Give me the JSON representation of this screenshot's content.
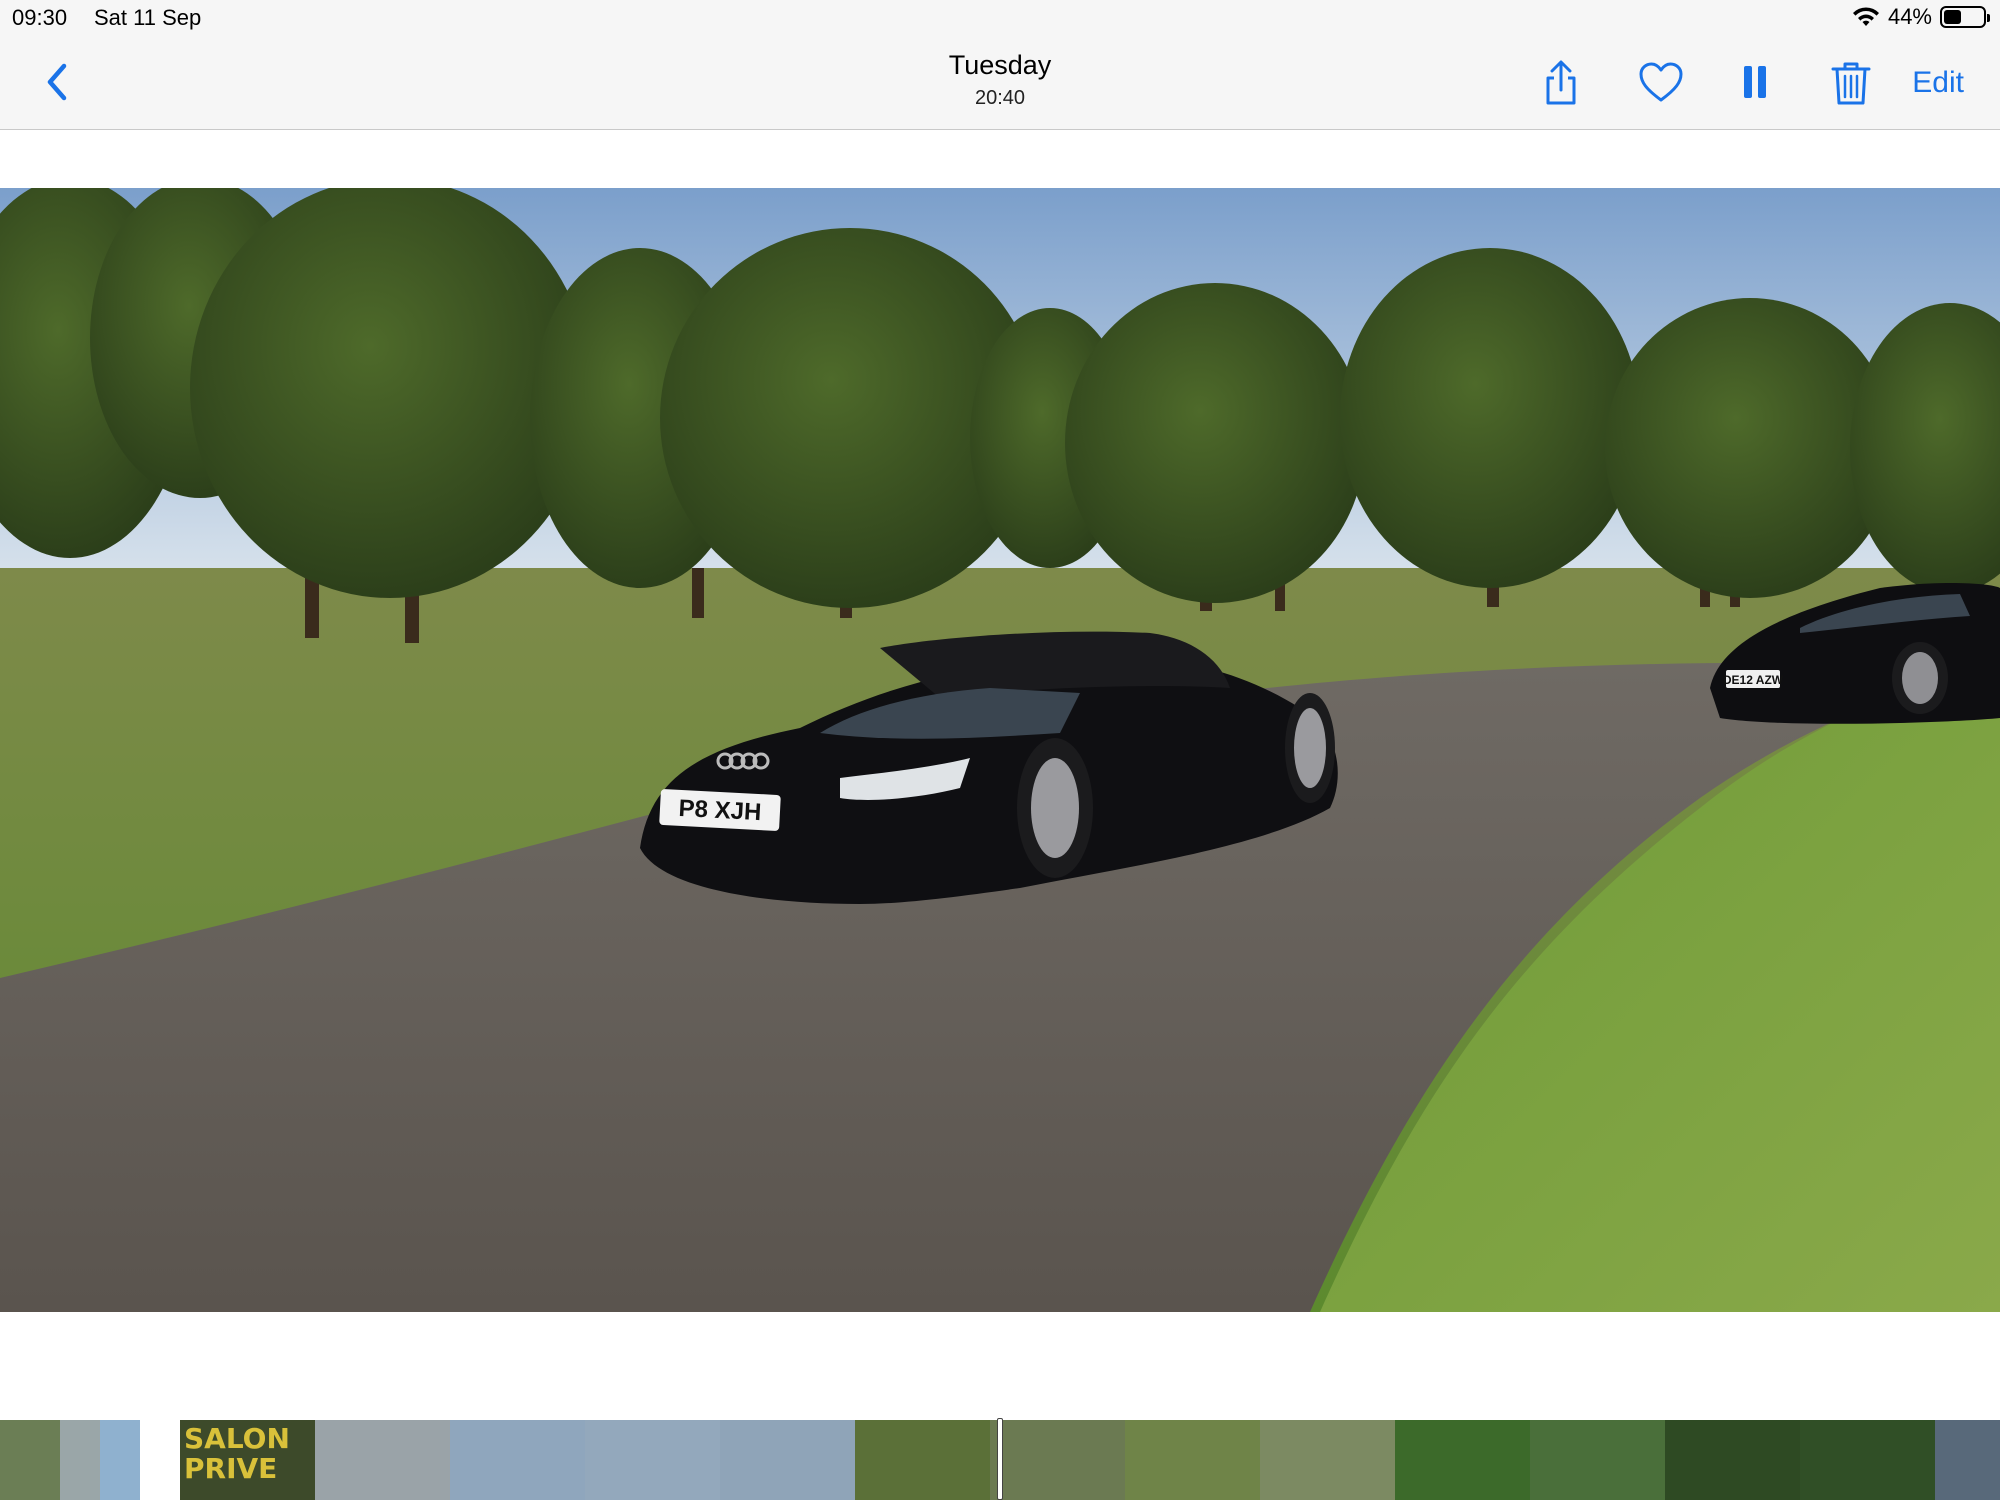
{
  "status_bar": {
    "time": "09:30",
    "date": "Sat 11 Sep",
    "battery_percent": "44%",
    "battery_level": 0.44,
    "icons": [
      "wifi-icon",
      "battery-icon"
    ]
  },
  "nav": {
    "title_day": "Tuesday",
    "title_time": "20:40",
    "edit_label": "Edit",
    "accent_color": "#1a73e8",
    "icons": [
      "back-chevron-icon",
      "share-icon",
      "heart-icon",
      "pause-icon",
      "trash-icon"
    ]
  },
  "photo": {
    "plate_front": "P8 XJH",
    "plate_rear": "DE12 AZW"
  },
  "filmstrip": {
    "thumb_text": "SALON PRIVE",
    "thumb_count": 19,
    "scrubber_position": 0.5
  }
}
